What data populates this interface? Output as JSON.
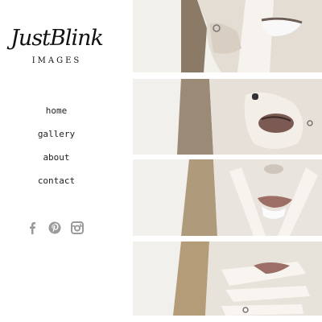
{
  "logo": {
    "script": "JustBlink",
    "sub": "IMAGES"
  },
  "nav": {
    "items": [
      "home",
      "gallery",
      "about",
      "contact"
    ]
  },
  "social": {
    "icons": [
      "facebook-icon",
      "pinterest-icon",
      "instagram-icon"
    ]
  },
  "gallery": {
    "strip_count": 4
  }
}
